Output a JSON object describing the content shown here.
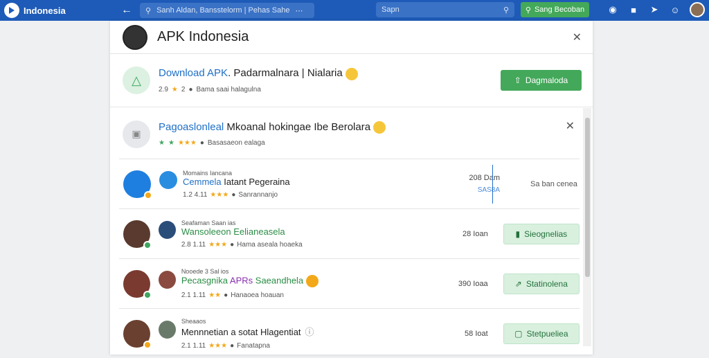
{
  "topbar": {
    "brand": "Indonesia",
    "search_left": "Sanh Aldan, Bansstelorm | Pehas Sahe",
    "search_right": "Sapn",
    "button_label": "Sang Becoban"
  },
  "dialog": {
    "title": "APK Indonesia",
    "download": {
      "title_blue": "Download APK",
      "title_rest": ". Padarmalnara | Nialaria",
      "rating": "2.9",
      "stars": "2",
      "meta": "Bama saai halagulna",
      "button": "Dagmaloda"
    },
    "section": {
      "title_blue": "Pagoaslonleal",
      "title_rest": " Mkoanal hokingae Ibe Berolara",
      "meta": "Basasaeon ealaga"
    },
    "items": [
      {
        "small_label": "Momains Iancana",
        "title": "Cemmela",
        "title_rest": " Iatant Pegeraina",
        "rating": "1.2 4.11",
        "meta": "Sanrannanjo",
        "size": "208 Dam",
        "size2": "SAS8A",
        "action": "Sa ban cenea"
      },
      {
        "small_label": "Seafaman Saan ias",
        "title": "Wansoleeon Eelianeasela",
        "rating": "2.8 1.11",
        "meta": "Hama aseala hoaeka",
        "size": "28 Ioan",
        "action": "Sieognelias"
      },
      {
        "small_label": "Nooede 3 Sal ios",
        "title": "Pecasgnika",
        "title_purple": " APRs",
        "title_rest": " Saeandhela",
        "rating": "2.1 1.11",
        "meta": "Hanaoea hoauan",
        "size": "390 Ioaa",
        "action": "Statinolena"
      },
      {
        "small_label": "Sheaaos",
        "title": "Mennnetian a sotat Hlagentiat",
        "rating": "2.1 1.11",
        "meta": "Fanatapna",
        "size": "58 Ioat",
        "action": "Stetpueliea"
      }
    ]
  }
}
